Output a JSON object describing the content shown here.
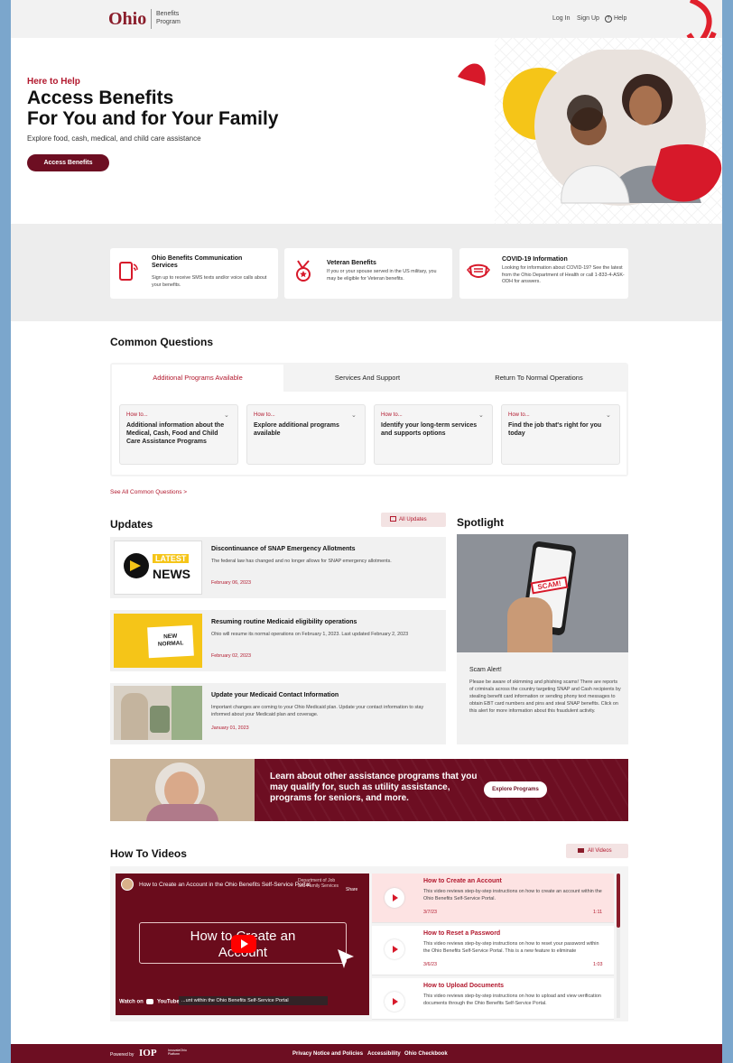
{
  "header": {
    "logo": "Ohio",
    "logo_sub": "Benefits Program",
    "login": "Log In",
    "signup": "Sign Up",
    "help": "Help"
  },
  "hero": {
    "kicker": "Here to Help",
    "title_line1": "Access Benefits",
    "title_line2": "For You and for Your Family",
    "subtitle": "Explore food, cash, medical, and child care assistance",
    "button": "Access Benefits"
  },
  "quick_cards": [
    {
      "title": "Ohio Benefits Communication Services",
      "text": "Sign up to receive SMS texts and/or voice calls about your benefits.",
      "icon": "phone-signal-icon"
    },
    {
      "title": "Veteran Benefits",
      "text": "If you or your spouse served in the US military, you may be eligible for Veteran benefits.",
      "icon": "medal-icon"
    },
    {
      "title": "COVID-19 Information",
      "text": "Looking for information about COVID-19? See the latest from the Ohio Department of Health or call 1-833-4-ASK-ODH for answers.",
      "icon": "mask-icon"
    }
  ],
  "common_questions": {
    "title": "Common Questions",
    "tabs": [
      "Additional Programs Available",
      "Services And Support",
      "Return To Normal Operations"
    ],
    "items": [
      {
        "small": "How to...",
        "text": "Additional information about the Medical, Cash, Food and Child Care Assistance Programs"
      },
      {
        "small": "How to...",
        "text": "Explore additional programs available"
      },
      {
        "small": "How to...",
        "text": "Identify your long-term services and supports options"
      },
      {
        "small": "How to...",
        "text": "Find the job that's right for you today"
      }
    ],
    "see_all": "See All Common Questions >"
  },
  "updates": {
    "title": "Updates",
    "all_button": "All Updates",
    "items": [
      {
        "title": "Discontinuance of SNAP Emergency Allotments",
        "text": "The federal law has changed and no longer allows for SNAP emergency allotments.",
        "date": "February 06, 2023",
        "img_text1": "LATEST",
        "img_text2": "NEWS"
      },
      {
        "title": "Resuming routine Medicaid eligibility operations",
        "text": "Ohio will resume its normal operations on February 1, 2023. Last updated February 2, 2023",
        "date": "February 02, 2023",
        "img_text1": "NEW",
        "img_text2": "NORMAL"
      },
      {
        "title": "Update your Medicaid Contact Information",
        "text": "Important changes are coming to your Ohio Medicaid plan. Update your contact information to stay informed about your Medicaid plan and coverage.",
        "date": "January 01, 2023"
      }
    ]
  },
  "spotlight": {
    "title": "Spotlight",
    "img_text": "SCAM!",
    "heading": "Scam Alert!",
    "text": "Please be aware of skimming and phishing scams! There are reports of criminals across the country targeting SNAP and Cash recipients by stealing benefit card information or sending phony text messages to obtain EBT card numbers and pins and steal SNAP benefits. Click on this alert for more information about this fraudulent activity."
  },
  "banner": {
    "text": "Learn about other assistance programs that you may qualify for, such as utility assistance, programs for seniors, and more.",
    "button": "Explore Programs"
  },
  "videos": {
    "title": "How To Videos",
    "all_button": "All Videos",
    "player": {
      "title": "How to Create an Account in the Ohio Benefits Self-Service Portal",
      "center_text_line1": "How to Create an",
      "center_text_line2": "Account",
      "caption": "...unt within the Ohio Benefits Self-Service Portal",
      "watch_on": "Watch on",
      "youtube": "YouTube",
      "share": "Share",
      "dept": "Department of Job and Family Services"
    },
    "items": [
      {
        "title": "How to Create an Account",
        "text": "This video reviews step-by-step instructions on how to create an account within the Ohio Benefits Self-Service Portal.",
        "date": "3/7/23",
        "duration": "1:11"
      },
      {
        "title": "How to Reset a Password",
        "text": "This video reviews step-by-step instructions on how to reset your password within the Ohio Benefits Self-Service Portal. This is a new feature to eliminate",
        "date": "3/6/23",
        "duration": "1:03"
      },
      {
        "title": "How to Upload Documents",
        "text": "This video reviews step-by-step instructions on how to upload and view verification documents through the Ohio Benefits Self-Service Portal.",
        "date": "",
        "duration": ""
      }
    ]
  },
  "footer": {
    "powered_by": "Powered by",
    "iop": "IOP",
    "iop_sub": "InnovateOhio Platform",
    "links": [
      "Privacy Notice and Policies",
      "Accessibility",
      "Ohio Checkbook"
    ]
  },
  "colors": {
    "maroon": "#6d0e22",
    "red": "#b2192e",
    "yellow": "#f5c518"
  }
}
